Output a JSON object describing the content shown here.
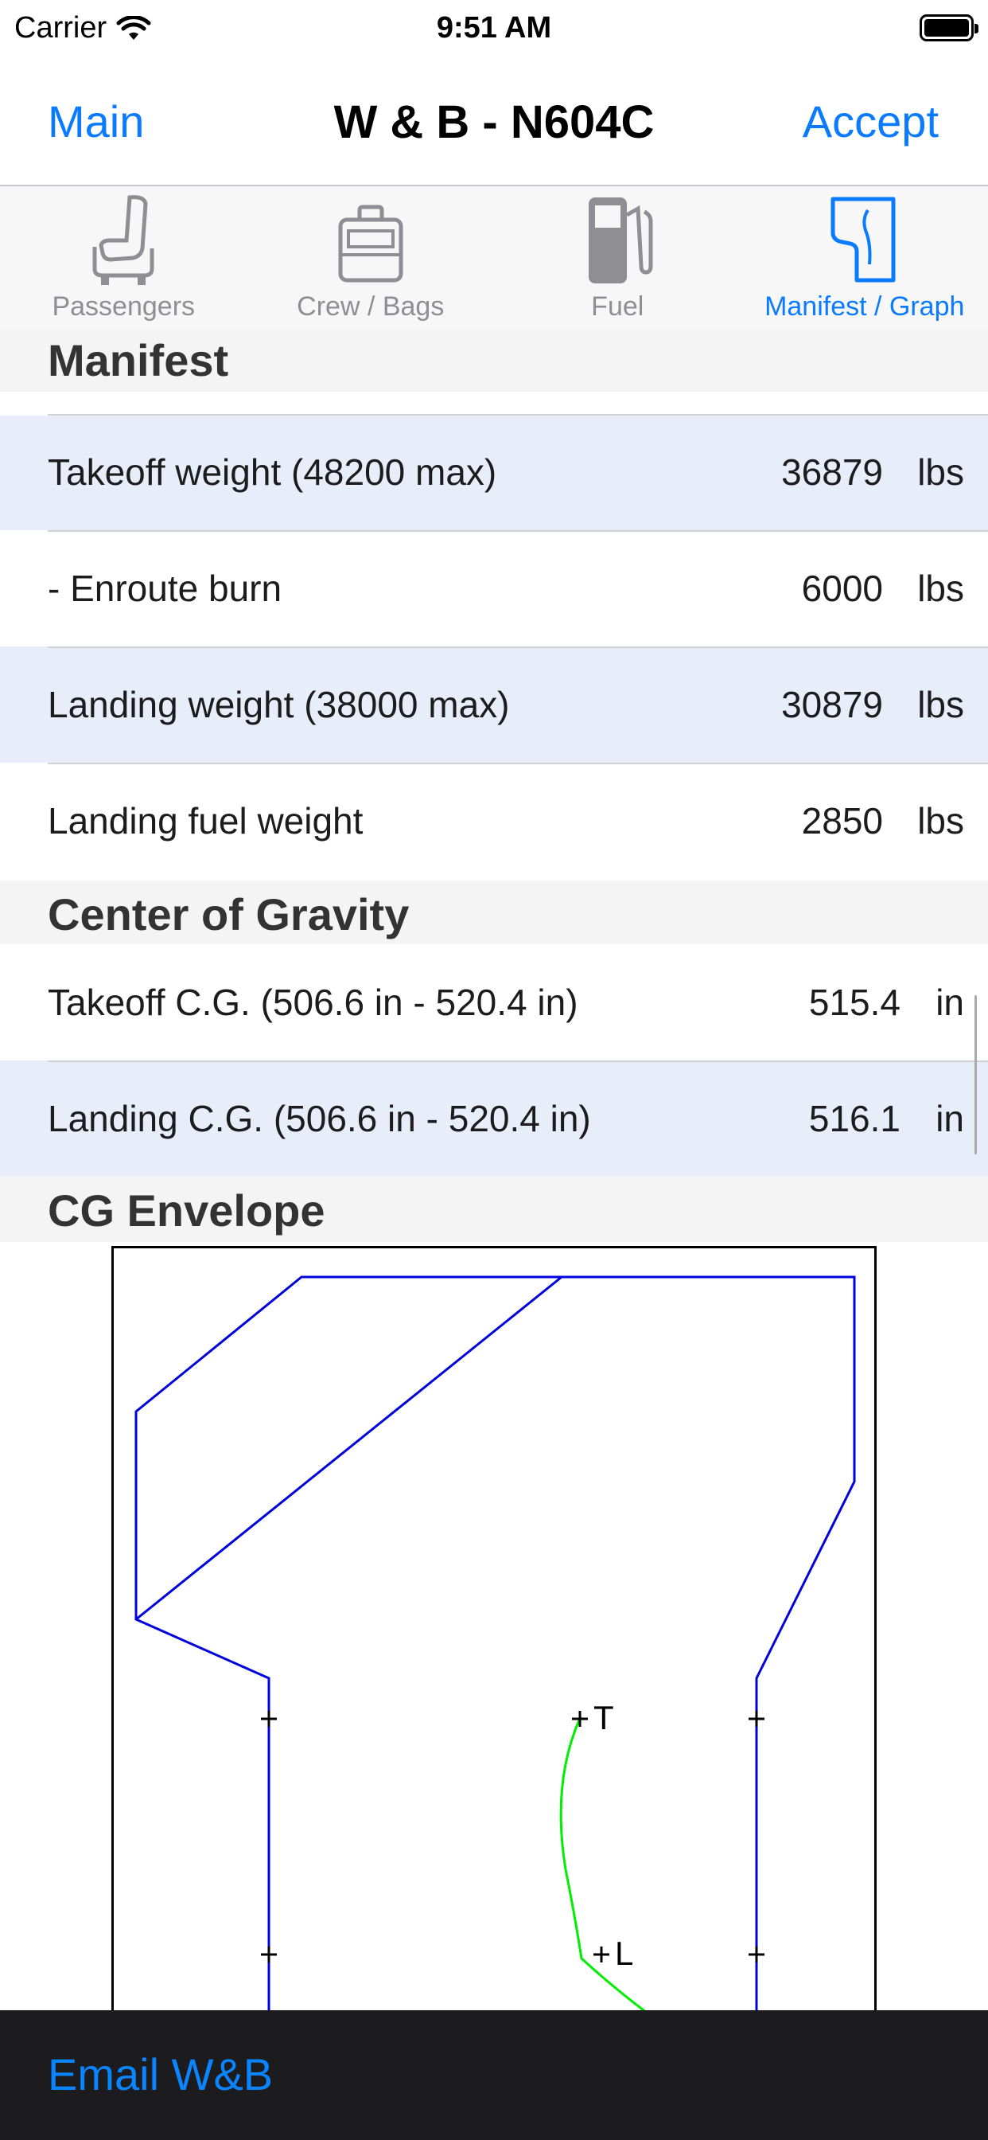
{
  "status_bar": {
    "carrier": "Carrier",
    "time": "9:51 AM"
  },
  "nav": {
    "back_label": "Main",
    "title": "W & B - N604C",
    "action_label": "Accept"
  },
  "tabs": [
    {
      "label": "Passengers",
      "icon": "seat-icon",
      "active": false
    },
    {
      "label": "Crew / Bags",
      "icon": "briefcase-icon",
      "active": false
    },
    {
      "label": "Fuel",
      "icon": "fuel-pump-icon",
      "active": false
    },
    {
      "label": "Manifest / Graph",
      "icon": "manifest-graph-icon",
      "active": true
    }
  ],
  "manifest": {
    "header": "Manifest",
    "rows": [
      {
        "label": "Takeoff weight (48200 max)",
        "value": "36879",
        "unit": "lbs"
      },
      {
        "label": "- Enroute burn",
        "value": "6000",
        "unit": "lbs"
      },
      {
        "label": "Landing weight (38000 max)",
        "value": "30879",
        "unit": "lbs"
      },
      {
        "label": "Landing fuel weight",
        "value": "2850",
        "unit": "lbs"
      }
    ]
  },
  "center_of_gravity": {
    "header": "Center of Gravity",
    "rows": [
      {
        "label": "Takeoff C.G. (506.6 in - 520.4 in)",
        "value": "515.4",
        "unit": "in"
      },
      {
        "label": "Landing C.G. (506.6 in - 520.4 in)",
        "value": "516.1",
        "unit": "in"
      }
    ]
  },
  "cg_envelope": {
    "header": "CG Envelope",
    "takeoff_marker": "T",
    "landing_marker": "L",
    "colors": {
      "envelope": "#0000dd",
      "path": "#00ee00",
      "markers": "#000000"
    }
  },
  "toolbar": {
    "email_label": "Email W&B"
  },
  "colors": {
    "accent": "#0a7aff",
    "alt_row": "#e7eef9",
    "toolbar_bg": "#1c1c1e"
  }
}
